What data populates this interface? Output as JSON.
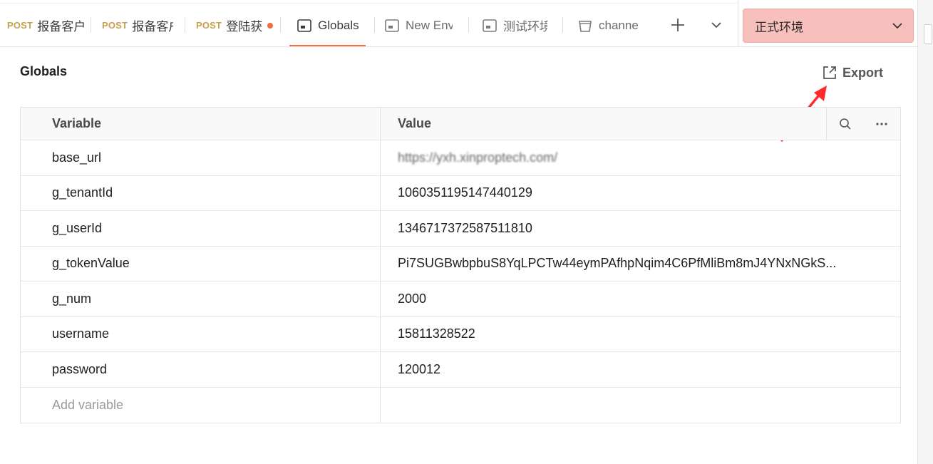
{
  "tabs": [
    {
      "method": "POST",
      "name": "报备客户",
      "type": "request"
    },
    {
      "method": "POST",
      "name": "报备客户",
      "type": "request"
    },
    {
      "method": "POST",
      "name": "登陆获",
      "type": "request",
      "unsaved": true
    },
    {
      "name": "Globals",
      "type": "globals",
      "active": true
    },
    {
      "name": "New Env",
      "type": "environment"
    },
    {
      "name": "测试环境",
      "type": "environment"
    },
    {
      "name": "channe",
      "type": "collection"
    }
  ],
  "tabbar": {
    "new_tab_icon": "plus-icon",
    "more_tabs_icon": "chevron-down-icon"
  },
  "environment_selector": {
    "selected": "正式环境",
    "color": "#f8c0bc"
  },
  "page": {
    "title": "Globals",
    "export_label": "Export"
  },
  "table": {
    "headers": {
      "variable": "Variable",
      "value": "Value"
    },
    "rows": [
      {
        "variable": "base_url",
        "value": "https://yxh.xinproptech.com/",
        "blurred": true
      },
      {
        "variable": "g_tenantId",
        "value": "1060351195147440129"
      },
      {
        "variable": "g_userId",
        "value": "1346717372587511810"
      },
      {
        "variable": "g_tokenValue",
        "value": "Pi7SUGBwbpbuS8YqLPCTw44eymPAfhpNqim4C6PfMliBm8mJ4YNxNGkS..."
      },
      {
        "variable": "g_num",
        "value": "2000"
      },
      {
        "variable": "username",
        "value": "15811328522"
      },
      {
        "variable": "password",
        "value": "120012"
      }
    ],
    "add_placeholder": "Add variable"
  },
  "colors": {
    "accent": "#ff6c37",
    "method_post": "#c8a04a",
    "annotation_arrow": "#ff2a2a"
  }
}
